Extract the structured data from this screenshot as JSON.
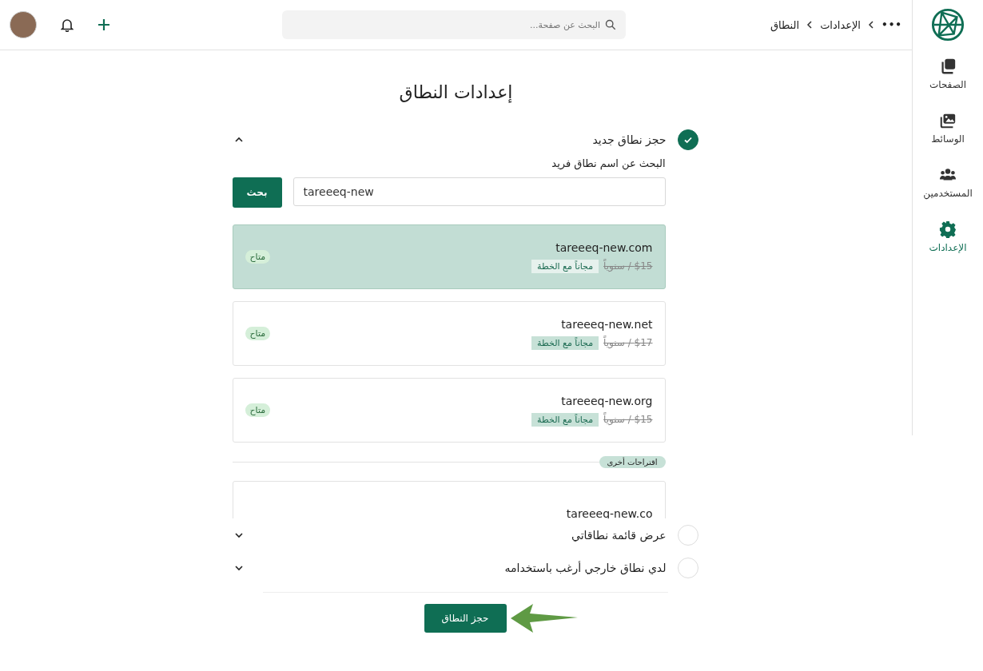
{
  "breadcrumb": {
    "more": "•••",
    "items": [
      {
        "label": "الإعدادات"
      },
      {
        "label": "النطاق"
      }
    ]
  },
  "search": {
    "placeholder": "البحث عن صفحة..."
  },
  "sidebar": {
    "items": [
      {
        "label": "الصفحات",
        "kind": "pages",
        "selected": false
      },
      {
        "label": "الوسائط",
        "kind": "media",
        "selected": false
      },
      {
        "label": "المستخدمين",
        "kind": "users",
        "selected": false
      },
      {
        "label": "الإعدادات",
        "kind": "settings",
        "selected": true
      }
    ]
  },
  "title": "إعدادات النطاق",
  "sections": [
    {
      "title": "حجز نطاق جديد",
      "checked": true,
      "expanded": true
    },
    {
      "title": "عرض قائمة نطاقاتي",
      "checked": false,
      "expanded": false
    },
    {
      "title": "لدي نطاق خارجي أرغب باستخدامه",
      "checked": false,
      "expanded": false
    }
  ],
  "domain_search": {
    "label": "البحث عن اسم نطاق فريد",
    "value": "tareeeq-new",
    "button": "بحث"
  },
  "domains": [
    {
      "name": "tareeeq-new.com",
      "price": "$15 / سنوياً",
      "free": "مجاناً مع الخطة",
      "status": "متاح",
      "selected": true
    },
    {
      "name": "tareeeq-new.net",
      "price": "$17 / سنوياً",
      "free": "مجاناً مع الخطة",
      "status": "متاح",
      "selected": false
    },
    {
      "name": "tareeeq-new.org",
      "price": "$15 / سنوياً",
      "free": "مجاناً مع الخطة",
      "status": "متاح",
      "selected": false
    }
  ],
  "other_label": "اقتراحات أخرى",
  "other_domains": [
    {
      "name": "tareeeq-new.co",
      "selected": false
    }
  ],
  "submit": "حجز النطاق"
}
